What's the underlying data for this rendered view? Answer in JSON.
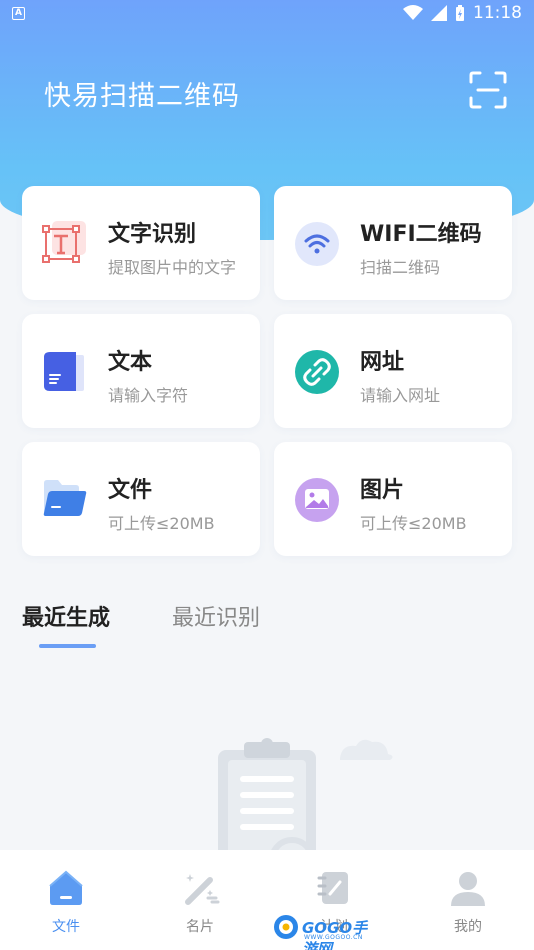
{
  "status_bar": {
    "time": "11:18",
    "notification_icon": "A"
  },
  "header": {
    "title": "快易扫描二维码",
    "scan_icon": "scan-frame-icon"
  },
  "cards": [
    {
      "title": "文字识别",
      "subtitle": "提取图片中的文字",
      "icon": "text-recognition-icon"
    },
    {
      "title": "WIFI二维码",
      "subtitle": "扫描二维码",
      "icon": "wifi-icon"
    },
    {
      "title": "文本",
      "subtitle": "请输入字符",
      "icon": "book-icon"
    },
    {
      "title": "网址",
      "subtitle": "请输入网址",
      "icon": "link-icon"
    },
    {
      "title": "文件",
      "subtitle": "可上传≤20MB",
      "icon": "folder-icon"
    },
    {
      "title": "图片",
      "subtitle": "可上传≤20MB",
      "icon": "image-icon"
    }
  ],
  "tabs": {
    "active": "最近生成",
    "inactive": "最近识别"
  },
  "bottom_nav": [
    {
      "label": "文件",
      "icon": "home-icon",
      "active": true
    },
    {
      "label": "名片",
      "icon": "wand-icon",
      "active": false
    },
    {
      "label": "计划",
      "icon": "notebook-icon",
      "active": false
    },
    {
      "label": "我的",
      "icon": "user-icon",
      "active": false
    }
  ],
  "watermark": {
    "text": "GOGO手游网",
    "sub": "WWW.GOGOO.CN"
  },
  "colors": {
    "accent": "#4a8ff0",
    "hero_top": "#6fa3fb",
    "hero_bottom": "#66c2f7"
  }
}
